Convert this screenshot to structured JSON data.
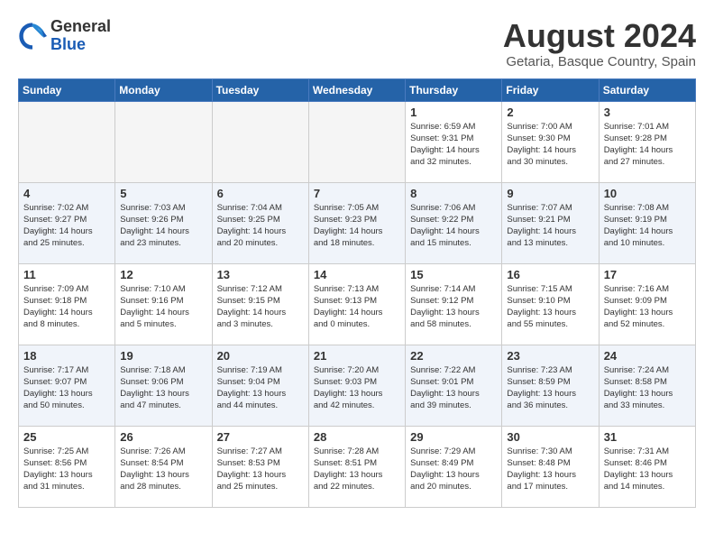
{
  "header": {
    "logo_line1": "General",
    "logo_line2": "Blue",
    "month_year": "August 2024",
    "location": "Getaria, Basque Country, Spain"
  },
  "weekdays": [
    "Sunday",
    "Monday",
    "Tuesday",
    "Wednesday",
    "Thursday",
    "Friday",
    "Saturday"
  ],
  "weeks": [
    [
      {
        "day": "",
        "info": "",
        "empty": true
      },
      {
        "day": "",
        "info": "",
        "empty": true
      },
      {
        "day": "",
        "info": "",
        "empty": true
      },
      {
        "day": "",
        "info": "",
        "empty": true
      },
      {
        "day": "1",
        "info": "Sunrise: 6:59 AM\nSunset: 9:31 PM\nDaylight: 14 hours\nand 32 minutes."
      },
      {
        "day": "2",
        "info": "Sunrise: 7:00 AM\nSunset: 9:30 PM\nDaylight: 14 hours\nand 30 minutes."
      },
      {
        "day": "3",
        "info": "Sunrise: 7:01 AM\nSunset: 9:28 PM\nDaylight: 14 hours\nand 27 minutes."
      }
    ],
    [
      {
        "day": "4",
        "info": "Sunrise: 7:02 AM\nSunset: 9:27 PM\nDaylight: 14 hours\nand 25 minutes."
      },
      {
        "day": "5",
        "info": "Sunrise: 7:03 AM\nSunset: 9:26 PM\nDaylight: 14 hours\nand 23 minutes."
      },
      {
        "day": "6",
        "info": "Sunrise: 7:04 AM\nSunset: 9:25 PM\nDaylight: 14 hours\nand 20 minutes."
      },
      {
        "day": "7",
        "info": "Sunrise: 7:05 AM\nSunset: 9:23 PM\nDaylight: 14 hours\nand 18 minutes."
      },
      {
        "day": "8",
        "info": "Sunrise: 7:06 AM\nSunset: 9:22 PM\nDaylight: 14 hours\nand 15 minutes."
      },
      {
        "day": "9",
        "info": "Sunrise: 7:07 AM\nSunset: 9:21 PM\nDaylight: 14 hours\nand 13 minutes."
      },
      {
        "day": "10",
        "info": "Sunrise: 7:08 AM\nSunset: 9:19 PM\nDaylight: 14 hours\nand 10 minutes."
      }
    ],
    [
      {
        "day": "11",
        "info": "Sunrise: 7:09 AM\nSunset: 9:18 PM\nDaylight: 14 hours\nand 8 minutes."
      },
      {
        "day": "12",
        "info": "Sunrise: 7:10 AM\nSunset: 9:16 PM\nDaylight: 14 hours\nand 5 minutes."
      },
      {
        "day": "13",
        "info": "Sunrise: 7:12 AM\nSunset: 9:15 PM\nDaylight: 14 hours\nand 3 minutes."
      },
      {
        "day": "14",
        "info": "Sunrise: 7:13 AM\nSunset: 9:13 PM\nDaylight: 14 hours\nand 0 minutes."
      },
      {
        "day": "15",
        "info": "Sunrise: 7:14 AM\nSunset: 9:12 PM\nDaylight: 13 hours\nand 58 minutes."
      },
      {
        "day": "16",
        "info": "Sunrise: 7:15 AM\nSunset: 9:10 PM\nDaylight: 13 hours\nand 55 minutes."
      },
      {
        "day": "17",
        "info": "Sunrise: 7:16 AM\nSunset: 9:09 PM\nDaylight: 13 hours\nand 52 minutes."
      }
    ],
    [
      {
        "day": "18",
        "info": "Sunrise: 7:17 AM\nSunset: 9:07 PM\nDaylight: 13 hours\nand 50 minutes."
      },
      {
        "day": "19",
        "info": "Sunrise: 7:18 AM\nSunset: 9:06 PM\nDaylight: 13 hours\nand 47 minutes."
      },
      {
        "day": "20",
        "info": "Sunrise: 7:19 AM\nSunset: 9:04 PM\nDaylight: 13 hours\nand 44 minutes."
      },
      {
        "day": "21",
        "info": "Sunrise: 7:20 AM\nSunset: 9:03 PM\nDaylight: 13 hours\nand 42 minutes."
      },
      {
        "day": "22",
        "info": "Sunrise: 7:22 AM\nSunset: 9:01 PM\nDaylight: 13 hours\nand 39 minutes."
      },
      {
        "day": "23",
        "info": "Sunrise: 7:23 AM\nSunset: 8:59 PM\nDaylight: 13 hours\nand 36 minutes."
      },
      {
        "day": "24",
        "info": "Sunrise: 7:24 AM\nSunset: 8:58 PM\nDaylight: 13 hours\nand 33 minutes."
      }
    ],
    [
      {
        "day": "25",
        "info": "Sunrise: 7:25 AM\nSunset: 8:56 PM\nDaylight: 13 hours\nand 31 minutes."
      },
      {
        "day": "26",
        "info": "Sunrise: 7:26 AM\nSunset: 8:54 PM\nDaylight: 13 hours\nand 28 minutes."
      },
      {
        "day": "27",
        "info": "Sunrise: 7:27 AM\nSunset: 8:53 PM\nDaylight: 13 hours\nand 25 minutes."
      },
      {
        "day": "28",
        "info": "Sunrise: 7:28 AM\nSunset: 8:51 PM\nDaylight: 13 hours\nand 22 minutes."
      },
      {
        "day": "29",
        "info": "Sunrise: 7:29 AM\nSunset: 8:49 PM\nDaylight: 13 hours\nand 20 minutes."
      },
      {
        "day": "30",
        "info": "Sunrise: 7:30 AM\nSunset: 8:48 PM\nDaylight: 13 hours\nand 17 minutes."
      },
      {
        "day": "31",
        "info": "Sunrise: 7:31 AM\nSunset: 8:46 PM\nDaylight: 13 hours\nand 14 minutes."
      }
    ]
  ]
}
